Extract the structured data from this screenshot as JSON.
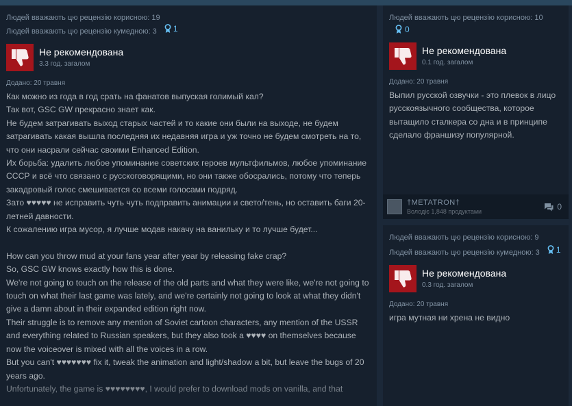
{
  "main_review": {
    "helpful": "Людей вважають цю рецензію корисною: 19",
    "funny": "Людей вважають цю рецензію кумедною: 3",
    "awards": "1",
    "verdict": "Не рекомендована",
    "hours": "3.3 год. загалом",
    "posted": "Додано: 20 травня",
    "paragraphs": [
      "Как можно из года в год срать на фанатов выпуская голимый кал?",
      "Так вот, GSC GW прекрасно знает как.",
      "Не будем затрагивать выход старых частей и то какие они были на выходе, не будем затрагивать какая вышла последняя их недавняя игра и уж точно не будем смотреть на то, что они насрали сейчас своими Enhanced Edition.",
      "Их борьба: удалить любое упоминание советских героев мультфильмов, любое упоминание СССР и всё что связано с русскоговорящими, но они также обосрались, потому что теперь закадровый голос смешивается со всеми голосами подряд.",
      "Зато ♥♥♥♥♥ не исправить чуть чуть подправить анимации и свето/тень, но оставить баги 20-летней давности.",
      "К сожалению игра мусор, я лучше модав накачу на ванильку и то лучше будет...",
      "",
      "How can you throw mud at your fans year after year by releasing fake crap?",
      "So, GSC GW knows exactly how this is done.",
      "We're not going to touch on the release of the old parts and what they were like, we're not going to touch on what their last game was lately, and we're certainly not going to look at what they didn't give a damn about in their expanded edition right now.",
      "Their struggle is to remove any mention of Soviet cartoon characters, any mention of the USSR and everything related to Russian speakers, but they also took a ♥♥♥♥ on themselves because now the voiceover is mixed with all the voices in a row.",
      "But you can't ♥♥♥♥♥♥♥ fix it, tweak the animation and light/shadow a bit, but leave the bugs of 20 years ago.",
      "Unfortunately, the game is ♥♥♥♥♥♥♥♥, I would prefer to download mods on vanilla, and that"
    ]
  },
  "right_review_1": {
    "helpful": "Людей вважають цю рецензію корисною: 10",
    "awards": "0",
    "verdict": "Не рекомендована",
    "hours": "0.1 год. загалом",
    "posted": "Додано: 20 травня",
    "body": "Выпил русской озвучки - это плевок в лицо русскоязычного сообщества, которое вытащило сталкера со дна и в принципе сделало франшизу популярной.",
    "author": "†METATRON†",
    "products": "Володіє 1,848 продуктами",
    "comments": "0"
  },
  "right_review_2": {
    "helpful": "Людей вважають цю рецензію корисною: 9",
    "funny": "Людей вважають цю рецензію кумедною: 3",
    "awards": "1",
    "verdict": "Не рекомендована",
    "hours": "0.3 год. загалом",
    "posted": "Додано: 20 травня",
    "body": "игра мутная ни хрена не видно"
  },
  "icons": {
    "thumb": "thumbs-down-icon",
    "award": "award-ribbon-icon",
    "comment": "comment-bubble-icon"
  },
  "colors": {
    "background": "#1b2838",
    "card": "#16202d",
    "thumb_bg": "#a4151c",
    "award": "#66c0f4"
  }
}
